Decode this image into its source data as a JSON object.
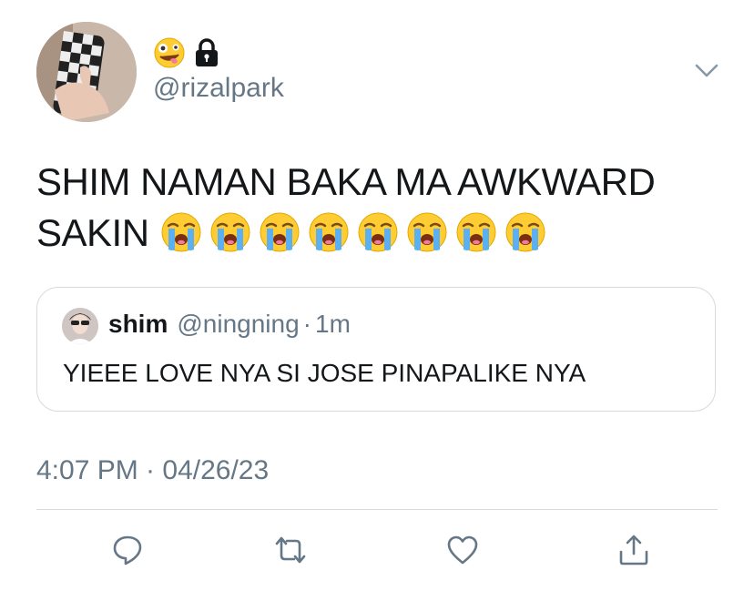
{
  "tweet": {
    "handle": "@rizalpark",
    "name_icons": [
      "zany-face-emoji",
      "lock-icon"
    ],
    "text_line1": "SHIM NAMAN BAKA MA AWKWARD",
    "text_line2": "SAKIN",
    "crying_emoji_count": 8,
    "timestamp": "4:07 PM · 04/26/23"
  },
  "quoted_tweet": {
    "name": "shim",
    "handle": "@ningning",
    "separator": "·",
    "time": "1m",
    "text": "YIEEE LOVE NYA SI JOSE PINAPALIKE NYA"
  },
  "actions": [
    "reply-icon",
    "retweet-icon",
    "like-icon",
    "share-icon"
  ],
  "colors": {
    "text": "#14171a",
    "secondary": "#657786",
    "border": "#d4dbe0"
  }
}
